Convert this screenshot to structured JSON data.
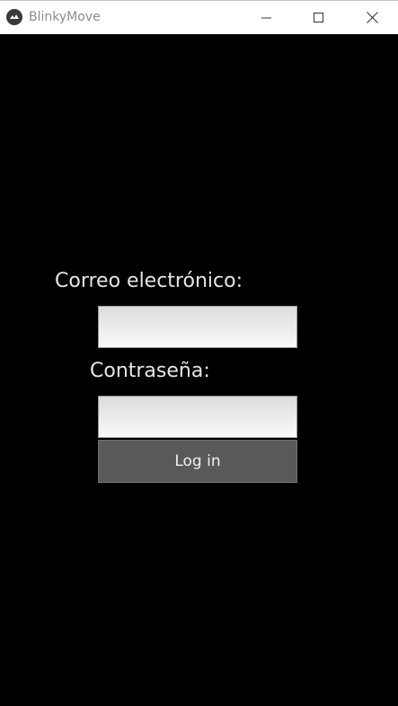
{
  "window": {
    "title": "BlinkyMove",
    "app_icon": "kivy-logo-icon",
    "controls": {
      "minimize_icon": "minimize-icon",
      "maximize_icon": "maximize-icon",
      "close_icon": "close-icon"
    }
  },
  "login_form": {
    "email_label": "Correo electrónico:",
    "email_value": "",
    "password_label": "Contraseña:",
    "password_value": "",
    "submit_label": "Log in"
  },
  "colors": {
    "background": "#000000",
    "titlebar": "#ffffff",
    "button": "#595959",
    "label_text": "#e6e6e6"
  }
}
